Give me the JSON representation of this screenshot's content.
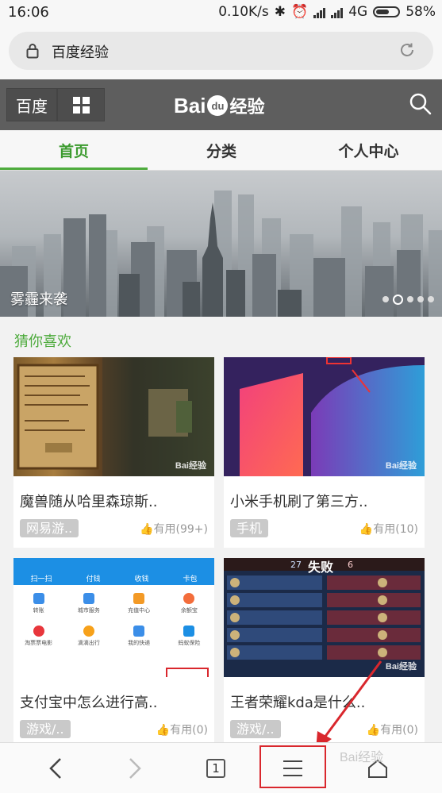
{
  "status_bar": {
    "time": "16:06",
    "network_speed": "0.10K/s",
    "network_type": "4G",
    "battery": "58%"
  },
  "url_bar": {
    "title": "百度经验",
    "lock_icon": "lock-icon",
    "reload_icon": "reload-icon"
  },
  "header": {
    "baidu_label": "百度",
    "logo": "Baidu经验",
    "grid_icon": "grid-icon",
    "search_icon": "search-icon"
  },
  "tabs": [
    {
      "label": "首页",
      "active": true
    },
    {
      "label": "分类",
      "active": false
    },
    {
      "label": "个人中心",
      "active": false
    }
  ],
  "banner": {
    "caption": "雾霾来袭",
    "dot_count": 5,
    "active_dot": 1
  },
  "section": {
    "title": "猜你喜欢"
  },
  "cards": [
    {
      "title": "魔兽随从哈里森琼斯..",
      "tag": "网易游..",
      "useful": "有用(99+)"
    },
    {
      "title": "小米手机刷了第三方..",
      "tag": "手机",
      "useful": "有用(10)"
    },
    {
      "title": "支付宝中怎么进行高..",
      "tag": "游戏/..",
      "useful": "有用(0)"
    },
    {
      "title": "王者荣耀kda是什么..",
      "tag": "游戏/..",
      "useful": "有用(0)"
    }
  ],
  "card_images": {
    "alipay_labels": [
      "扫一扫",
      "付钱",
      "收钱",
      "卡包"
    ],
    "alipay_grid": [
      "转账",
      "城市服务",
      "充值中心",
      "余额宝",
      "淘票票电影",
      "滴滴出行",
      "我的快递",
      "蚂蚁保险"
    ],
    "game_defeat": "失败",
    "game_score": "27",
    "game_score2": "6"
  },
  "watermark": "Bai经验",
  "bottom_bar": {
    "back_icon": "back-arrow-icon",
    "forward_icon": "forward-arrow-icon",
    "tab_count": "1",
    "menu_icon": "menu-icon",
    "home_icon": "home-icon"
  }
}
